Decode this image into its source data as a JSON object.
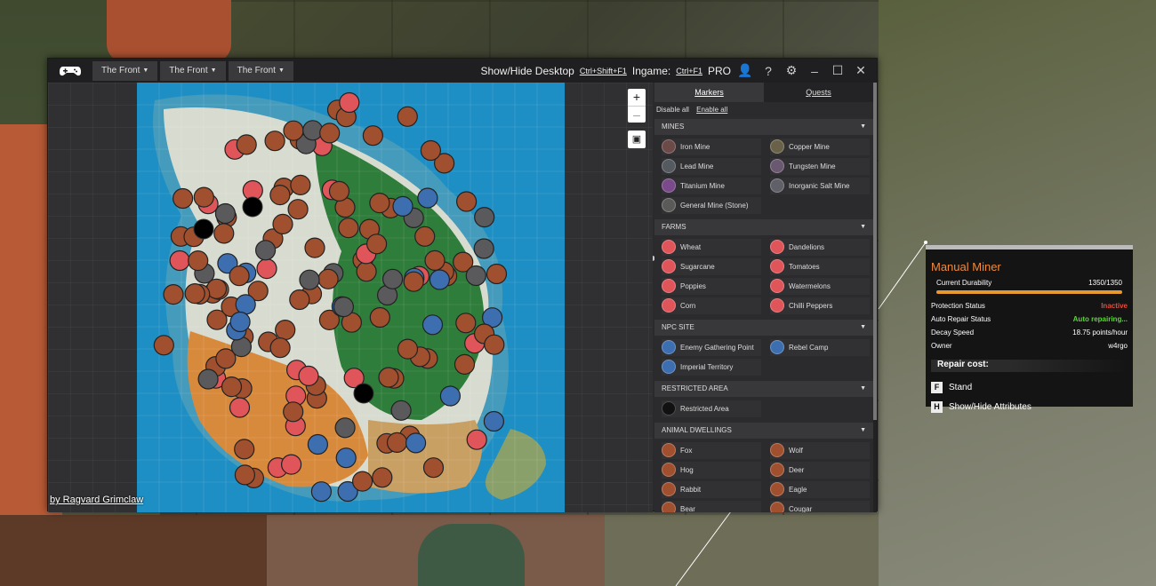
{
  "titlebar": {
    "tabs": [
      "The Front",
      "The Front",
      "The Front"
    ],
    "show_hide_label": "Show/Hide Desktop",
    "show_hide_key": "Ctrl+Shift+F1",
    "ingame_label": "Ingame:",
    "ingame_key": "Ctrl+F1",
    "pro_label": "PRO",
    "icons": [
      "user-icon",
      "help-icon",
      "gear-icon",
      "minimize-icon",
      "maximize-icon",
      "close-icon"
    ]
  },
  "map": {
    "zoom_in": "+",
    "zoom_out": "–",
    "credit": "by Ragvard Grimclaw"
  },
  "panel": {
    "tabs": [
      "Markers",
      "Quests"
    ],
    "disable_all": "Disable all",
    "enable_all": "Enable all",
    "categories": [
      {
        "name": "MINES",
        "items": [
          {
            "label": "Iron Mine",
            "color": "#6b4a48"
          },
          {
            "label": "Copper Mine",
            "color": "#6a6248"
          },
          {
            "label": "Lead Mine",
            "color": "#555a60"
          },
          {
            "label": "Tungsten Mine",
            "color": "#6a5870"
          },
          {
            "label": "Titanium Mine",
            "color": "#7a4a8a"
          },
          {
            "label": "Inorganic Salt Mine",
            "color": "#606068"
          },
          {
            "label": "General Mine (Stone)",
            "color": "#5a5a58"
          }
        ]
      },
      {
        "name": "FARMS",
        "items": [
          {
            "label": "Wheat",
            "color": "#e0555a"
          },
          {
            "label": "Dandelions",
            "color": "#e0555a"
          },
          {
            "label": "Sugarcane",
            "color": "#e0555a"
          },
          {
            "label": "Tomatoes",
            "color": "#e0555a"
          },
          {
            "label": "Poppies",
            "color": "#e0555a"
          },
          {
            "label": "Watermelons",
            "color": "#e0555a"
          },
          {
            "label": "Corn",
            "color": "#e0555a"
          },
          {
            "label": "Chilli Peppers",
            "color": "#e0555a"
          }
        ]
      },
      {
        "name": "NPC SITE",
        "items": [
          {
            "label": "Enemy Gathering Point",
            "color": "#3d6fb0"
          },
          {
            "label": "Rebel Camp",
            "color": "#3d6fb0"
          },
          {
            "label": "Imperial Territory",
            "color": "#3d6fb0"
          }
        ]
      },
      {
        "name": "RESTRICTED AREA",
        "items": [
          {
            "label": "Restricted Area",
            "color": "#111111"
          }
        ]
      },
      {
        "name": "ANIMAL DWELLINGS",
        "items": [
          {
            "label": "Fox",
            "color": "#a0502e"
          },
          {
            "label": "Wolf",
            "color": "#a0502e"
          },
          {
            "label": "Hog",
            "color": "#a0502e"
          },
          {
            "label": "Deer",
            "color": "#a0502e"
          },
          {
            "label": "Rabbit",
            "color": "#a0502e"
          },
          {
            "label": "Eagle",
            "color": "#a0502e"
          },
          {
            "label": "Bear",
            "color": "#a0502e"
          },
          {
            "label": "Cougar",
            "color": "#a0502e"
          }
        ]
      }
    ]
  },
  "tooltip": {
    "title": "Manual Miner",
    "rows": [
      {
        "label": "Current Durability",
        "value": "1350/1350",
        "color": "#ffffff"
      },
      {
        "label": "Protection Status",
        "value": "Inactive",
        "color": "#e84a3a"
      },
      {
        "label": "Auto Repair Status",
        "value": "Auto repairing...",
        "color": "#5fd33a"
      },
      {
        "label": "Decay Speed",
        "value": "18.75 points/hour",
        "color": "#ffffff"
      },
      {
        "label": "Owner",
        "value": "w4rgo",
        "color": "#ffffff"
      }
    ],
    "durability_fraction": 1.0,
    "repair_cost": "Repair cost:",
    "keys": [
      {
        "key": "F",
        "label": "Stand"
      },
      {
        "key": "H",
        "label": "Show/Hide Attributes"
      }
    ]
  }
}
